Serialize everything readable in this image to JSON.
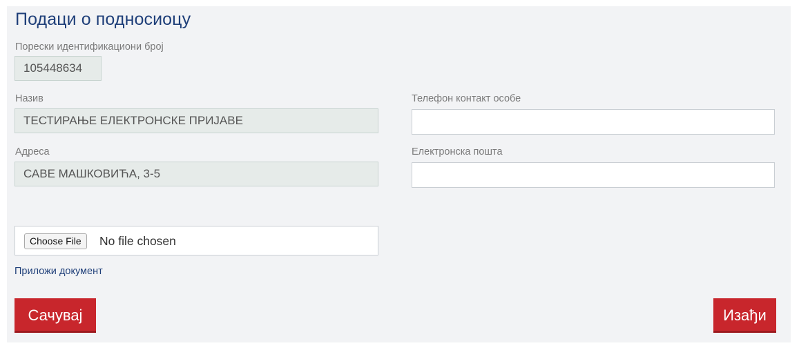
{
  "section": {
    "title": "Подаци о подносиоцу"
  },
  "fields": {
    "tax_id": {
      "label": "Порески идентификациони број",
      "value": "105448634"
    },
    "name": {
      "label": "Назив",
      "value": "ТЕСТИРАЊЕ ЕЛЕКТРОНСКЕ ПРИЈАВЕ"
    },
    "address": {
      "label": "Адреса",
      "value": "САВЕ МАШКОВИЋА, 3-5"
    },
    "phone": {
      "label": "Телефон контакт особе",
      "value": ""
    },
    "email": {
      "label": "Електронска пошта",
      "value": ""
    }
  },
  "file_upload": {
    "button_label": "Choose File",
    "status": "No file chosen"
  },
  "attach_link": "Приложи документ",
  "buttons": {
    "save": "Сачувај",
    "exit": "Изађи"
  },
  "colors": {
    "title": "#1f3f79",
    "button": "#c8262c",
    "panel_background": "#f2f3f5",
    "readonly_field": "#e6ebe9"
  }
}
